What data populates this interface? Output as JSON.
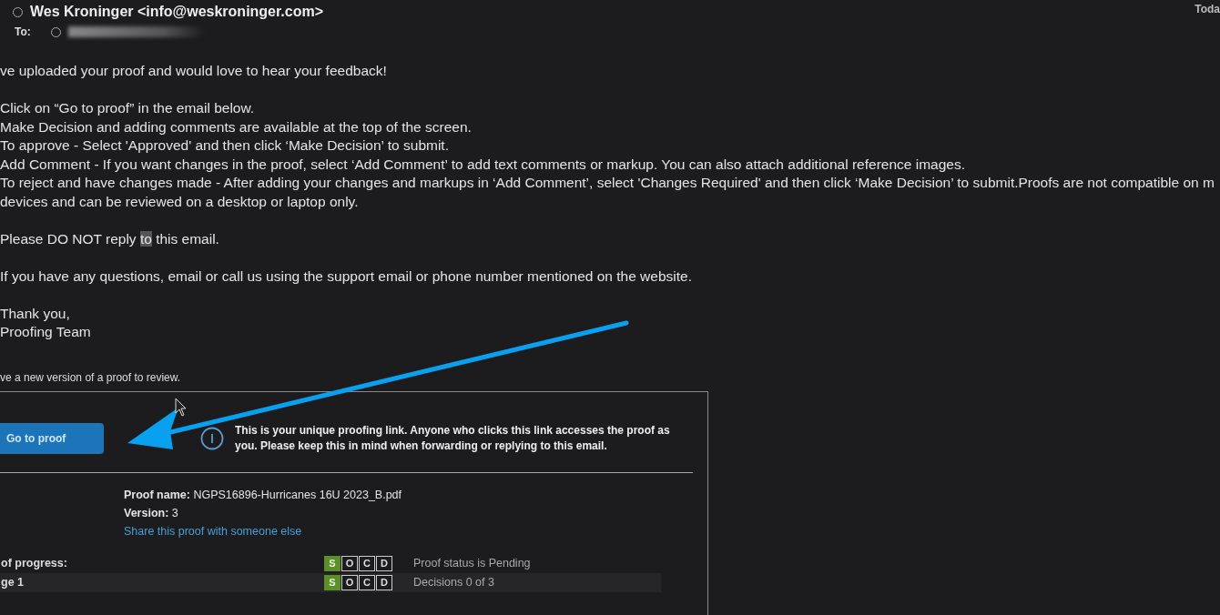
{
  "header": {
    "sender": "Wes Kroninger <info@weskroninger.com>",
    "to_label": "To:",
    "date": "Toda"
  },
  "body": [
    {
      "kind": "line",
      "text": "ve uploaded your proof and would love to hear your feedback!"
    },
    {
      "kind": "gap"
    },
    {
      "kind": "line",
      "text": "Click on “Go to proof” in the email below."
    },
    {
      "kind": "line",
      "text": "Make Decision and adding comments are available at the top of the screen."
    },
    {
      "kind": "line",
      "text": "To approve - Select 'Approved' and then click ‘Make Decision’ to submit."
    },
    {
      "kind": "line",
      "text": "Add Comment - If you want changes in the proof, select ‘Add Comment’ to add text comments or markup. You can also attach additional reference images."
    },
    {
      "kind": "line",
      "text": "To reject and have changes made - After adding your changes and markups in ‘Add Comment’, select 'Changes Required' and then click ‘Make Decision’ to submit.Proofs are not compatible on m"
    },
    {
      "kind": "line",
      "text": "devices and can be reviewed on a desktop or laptop only."
    },
    {
      "kind": "gap"
    },
    {
      "kind": "highlighted",
      "before": "Please DO NOT reply ",
      "highlight": "to",
      "after": " this email."
    },
    {
      "kind": "gap"
    },
    {
      "kind": "line",
      "text": "If you have any questions, email or call us using the support email or phone number mentioned on the website."
    },
    {
      "kind": "gap"
    },
    {
      "kind": "line",
      "text": "Thank you,"
    },
    {
      "kind": "line",
      "text": "Proofing Team"
    }
  ],
  "intro": "ve a new version of a proof to review.",
  "card": {
    "button": "Go to proof",
    "notice": "This is your unique proofing link. Anyone who clicks this link accesses the proof as you. Please keep this in mind when forwarding or replying to this email.",
    "proof_name_label": "Proof name:",
    "proof_name": "NGPS16896-Hurricanes 16U 2023_B.pdf",
    "version_label": "Version:",
    "version": "3",
    "share_link": "Share this proof with someone else",
    "progress": [
      {
        "label": "of progress:",
        "steps": [
          {
            "letter": "S",
            "selected": true
          },
          {
            "letter": "O",
            "selected": false
          },
          {
            "letter": "C",
            "selected": false
          },
          {
            "letter": "D",
            "selected": false
          }
        ],
        "status": "Proof status is Pending"
      },
      {
        "label": "ge 1",
        "steps": [
          {
            "letter": "S",
            "selected": true
          },
          {
            "letter": "O",
            "selected": false
          },
          {
            "letter": "C",
            "selected": false
          },
          {
            "letter": "D",
            "selected": false
          }
        ],
        "status": "Decisions 0 of 3"
      }
    ]
  }
}
